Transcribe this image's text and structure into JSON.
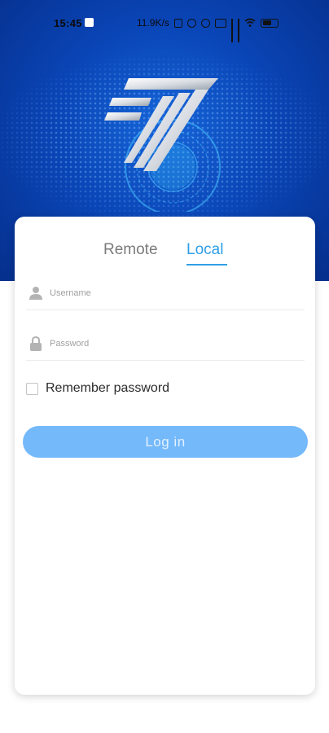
{
  "status_bar": {
    "time": "15:45",
    "net_speed": "11.9K/s"
  },
  "tabs": {
    "remote": "Remote",
    "local": "Local",
    "active": "local"
  },
  "form": {
    "username_placeholder": "Username",
    "username_value": "",
    "password_placeholder": "Password",
    "password_value": "",
    "remember_label": "Remember password",
    "remember_checked": false,
    "login_label": "Log in"
  },
  "colors": {
    "hero_blue": "#0a46b8",
    "accent": "#2e9fe6",
    "button": "#74b9fa"
  }
}
